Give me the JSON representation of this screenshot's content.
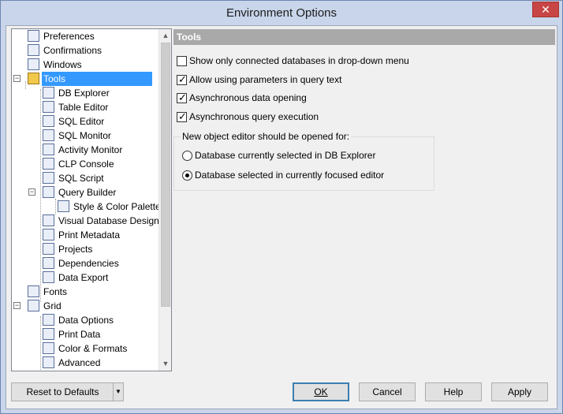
{
  "window": {
    "title": "Environment Options",
    "close_glyph": "✕"
  },
  "tree": {
    "items": [
      {
        "label": "Preferences"
      },
      {
        "label": "Confirmations"
      },
      {
        "label": "Windows"
      },
      {
        "label": "Tools"
      },
      {
        "label": "DB Explorer"
      },
      {
        "label": "Table Editor"
      },
      {
        "label": "SQL Editor"
      },
      {
        "label": "SQL Monitor"
      },
      {
        "label": "Activity Monitor"
      },
      {
        "label": "CLP Console"
      },
      {
        "label": "SQL Script"
      },
      {
        "label": "Query Builder"
      },
      {
        "label": "Style & Color Palette"
      },
      {
        "label": "Visual Database Designer"
      },
      {
        "label": "Print Metadata"
      },
      {
        "label": "Projects"
      },
      {
        "label": "Dependencies"
      },
      {
        "label": "Data Export"
      },
      {
        "label": "Fonts"
      },
      {
        "label": "Grid"
      },
      {
        "label": "Data Options"
      },
      {
        "label": "Print Data"
      },
      {
        "label": "Color & Formats"
      },
      {
        "label": "Advanced"
      }
    ]
  },
  "panel": {
    "header": "Tools",
    "checks": [
      {
        "label": "Show only connected databases in drop-down menu",
        "checked": false
      },
      {
        "label": "Allow using parameters in query text",
        "checked": true
      },
      {
        "label": "Asynchronous data opening",
        "checked": true
      },
      {
        "label": "Asynchronous query execution",
        "checked": true
      }
    ],
    "group_title": "New object editor should be opened for:",
    "radios": [
      {
        "label": "Database currently selected in DB Explorer",
        "selected": false
      },
      {
        "label": "Database selected in currently focused editor",
        "selected": true
      }
    ]
  },
  "buttons": {
    "reset": "Reset to Defaults",
    "ok": "OK",
    "cancel": "Cancel",
    "help": "Help",
    "apply": "Apply"
  },
  "colors": {
    "selection": "#3399ff",
    "panel_header": "#a9a9a9"
  }
}
